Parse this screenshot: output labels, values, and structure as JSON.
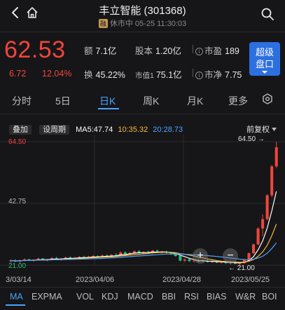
{
  "header": {
    "title": "丰立智能 (301368)",
    "margin_badge": "融",
    "status": "休市中 05-25 11:30:03"
  },
  "quote": {
    "price": "62.53",
    "change": "6.72",
    "change_pct": "12.04%",
    "amount_label": "额",
    "amount": "7.1亿",
    "equity_label": "股本",
    "equity": "1.20亿",
    "pe_label": "市盈",
    "pe": "189",
    "turnover_label": "换",
    "turnover": "45.22%",
    "mcap_label": "市值1",
    "mcap": "75.1亿",
    "pb_label": "市净",
    "pb": "7.75",
    "info_glyph": "i"
  },
  "super_button": {
    "line1": "超级",
    "line2": "盘口"
  },
  "tabs": [
    "分时",
    "5日",
    "日K",
    "周K",
    "月K",
    "更多"
  ],
  "active_tab": "日K",
  "chart_tools": {
    "overlay_label": "叠加",
    "period_label": "设周期",
    "ma5_label": "MA5:47.74",
    "ma10_label": "10:35.32",
    "ma20_label": "20:28.73",
    "adjust_label": "前复权"
  },
  "price_axis": {
    "top": "64.50",
    "mid": "42.75",
    "bottom": "21.00",
    "high_marker": "64.50",
    "low_marker": "21.00"
  },
  "date_axis": [
    "3/03/14",
    "2023/04/06",
    "2023/04/28",
    "2023/05/25"
  ],
  "indicators": [
    "MA",
    "EXPMA",
    "VOL",
    "KDJ",
    "MACD",
    "BBI",
    "RSI",
    "BIAS",
    "W&R",
    "BOI"
  ],
  "active_indicator": "MA",
  "colors": {
    "up": "#f0453c",
    "down": "#22c07a",
    "ma5": "#ffffff",
    "ma10": "#f6b93b",
    "ma20": "#4aa3ff",
    "accent": "#4aa3ff",
    "button": "#2c6fe0"
  },
  "chart_data": {
    "type": "candlestick",
    "y_range": [
      21.0,
      64.5
    ],
    "candles": [
      {
        "o": 22.4,
        "h": 23.0,
        "l": 21.9,
        "c": 22.6
      },
      {
        "o": 22.6,
        "h": 23.1,
        "l": 22.1,
        "c": 22.3
      },
      {
        "o": 22.3,
        "h": 22.9,
        "l": 21.8,
        "c": 22.7
      },
      {
        "o": 22.7,
        "h": 23.4,
        "l": 22.3,
        "c": 23.0
      },
      {
        "o": 23.0,
        "h": 23.3,
        "l": 22.5,
        "c": 22.6
      },
      {
        "o": 22.6,
        "h": 23.1,
        "l": 22.2,
        "c": 22.9
      },
      {
        "o": 22.9,
        "h": 23.6,
        "l": 22.6,
        "c": 23.3
      },
      {
        "o": 23.3,
        "h": 23.5,
        "l": 22.7,
        "c": 22.8
      },
      {
        "o": 22.8,
        "h": 23.2,
        "l": 22.3,
        "c": 23.0
      },
      {
        "o": 23.0,
        "h": 23.8,
        "l": 22.7,
        "c": 23.5
      },
      {
        "o": 23.5,
        "h": 23.9,
        "l": 22.9,
        "c": 23.1
      },
      {
        "o": 23.1,
        "h": 23.5,
        "l": 22.6,
        "c": 23.3
      },
      {
        "o": 23.3,
        "h": 24.0,
        "l": 23.0,
        "c": 23.7
      },
      {
        "o": 23.7,
        "h": 24.1,
        "l": 23.1,
        "c": 23.4
      },
      {
        "o": 23.4,
        "h": 23.9,
        "l": 22.9,
        "c": 23.6
      },
      {
        "o": 23.6,
        "h": 24.2,
        "l": 23.2,
        "c": 23.9
      },
      {
        "o": 23.9,
        "h": 24.3,
        "l": 23.3,
        "c": 23.6
      },
      {
        "o": 23.6,
        "h": 24.3,
        "l": 23.2,
        "c": 24.0
      },
      {
        "o": 24.0,
        "h": 24.6,
        "l": 23.6,
        "c": 24.2
      },
      {
        "o": 24.2,
        "h": 24.5,
        "l": 23.5,
        "c": 23.8
      },
      {
        "o": 23.8,
        "h": 24.7,
        "l": 23.4,
        "c": 24.4
      },
      {
        "o": 24.4,
        "h": 24.8,
        "l": 23.8,
        "c": 24.0
      },
      {
        "o": 24.0,
        "h": 24.9,
        "l": 23.7,
        "c": 24.6
      },
      {
        "o": 24.6,
        "h": 25.2,
        "l": 24.1,
        "c": 24.5
      },
      {
        "o": 24.5,
        "h": 25.8,
        "l": 24.3,
        "c": 25.5
      },
      {
        "o": 25.5,
        "h": 25.9,
        "l": 24.7,
        "c": 24.9
      },
      {
        "o": 24.9,
        "h": 25.6,
        "l": 24.5,
        "c": 25.3
      },
      {
        "o": 25.3,
        "h": 26.2,
        "l": 25.0,
        "c": 25.9
      },
      {
        "o": 25.9,
        "h": 26.3,
        "l": 25.0,
        "c": 25.2
      },
      {
        "o": 25.2,
        "h": 25.9,
        "l": 24.8,
        "c": 25.6
      },
      {
        "o": 25.6,
        "h": 26.1,
        "l": 25.1,
        "c": 25.4
      },
      {
        "o": 25.4,
        "h": 26.4,
        "l": 25.2,
        "c": 26.1
      },
      {
        "o": 26.1,
        "h": 26.5,
        "l": 25.3,
        "c": 25.5
      },
      {
        "o": 25.5,
        "h": 26.0,
        "l": 25.0,
        "c": 25.7
      },
      {
        "o": 25.7,
        "h": 26.2,
        "l": 25.1,
        "c": 25.3
      },
      {
        "o": 25.3,
        "h": 25.6,
        "l": 24.6,
        "c": 24.8
      },
      {
        "o": 24.8,
        "h": 25.2,
        "l": 24.0,
        "c": 24.2
      },
      {
        "o": 24.2,
        "h": 24.5,
        "l": 22.3,
        "c": 22.6
      },
      {
        "o": 22.6,
        "h": 23.3,
        "l": 22.1,
        "c": 23.0
      },
      {
        "o": 23.0,
        "h": 23.4,
        "l": 22.2,
        "c": 22.4
      },
      {
        "o": 22.4,
        "h": 22.9,
        "l": 21.9,
        "c": 22.6
      },
      {
        "o": 22.6,
        "h": 23.1,
        "l": 22.0,
        "c": 22.3
      },
      {
        "o": 22.3,
        "h": 22.8,
        "l": 21.8,
        "c": 22.5
      },
      {
        "o": 22.5,
        "h": 22.9,
        "l": 21.9,
        "c": 22.1
      },
      {
        "o": 22.1,
        "h": 22.6,
        "l": 21.7,
        "c": 22.3
      },
      {
        "o": 22.3,
        "h": 22.7,
        "l": 21.7,
        "c": 21.9
      },
      {
        "o": 21.9,
        "h": 22.4,
        "l": 21.5,
        "c": 22.1
      },
      {
        "o": 22.1,
        "h": 22.5,
        "l": 21.4,
        "c": 21.7
      },
      {
        "o": 21.7,
        "h": 22.1,
        "l": 21.2,
        "c": 21.9
      },
      {
        "o": 21.9,
        "h": 22.3,
        "l": 21.3,
        "c": 21.5
      },
      {
        "o": 21.5,
        "h": 21.9,
        "l": 21.0,
        "c": 21.7
      },
      {
        "o": 21.7,
        "h": 23.2,
        "l": 21.5,
        "c": 23.0
      },
      {
        "o": 23.0,
        "h": 25.4,
        "l": 22.8,
        "c": 25.2
      },
      {
        "o": 25.2,
        "h": 28.6,
        "l": 24.9,
        "c": 28.3
      },
      {
        "o": 28.3,
        "h": 34.3,
        "l": 28.0,
        "c": 33.9
      },
      {
        "o": 33.9,
        "h": 38.9,
        "l": 31.2,
        "c": 37.2
      },
      {
        "o": 37.2,
        "h": 46.0,
        "l": 36.8,
        "c": 45.6
      },
      {
        "o": 45.6,
        "h": 56.3,
        "l": 45.0,
        "c": 55.8
      },
      {
        "o": 55.8,
        "h": 64.5,
        "l": 55.2,
        "c": 62.5
      }
    ]
  }
}
